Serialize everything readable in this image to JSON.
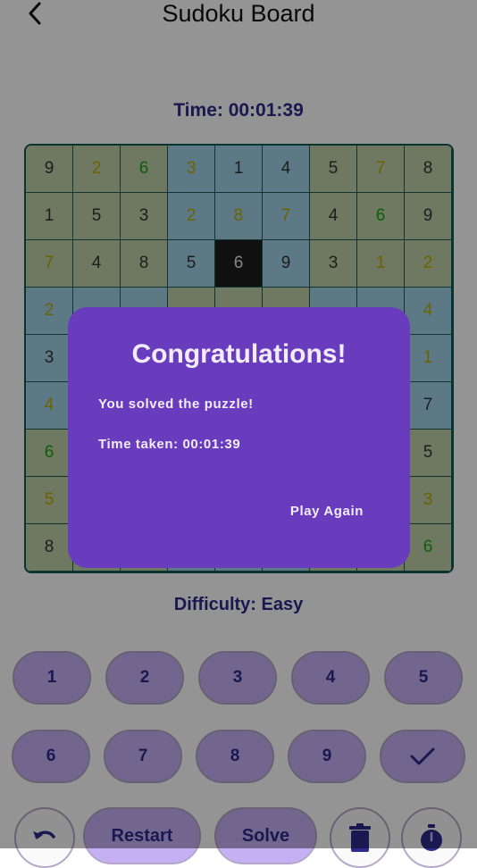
{
  "header": {
    "title": "Sudoku Board",
    "back_icon": "chevron-left-icon"
  },
  "timer": {
    "text": "Time: 00:01:39"
  },
  "board": {
    "rows": [
      [
        {
          "v": "9",
          "bg": "a"
        },
        {
          "v": "2",
          "bg": "a",
          "c": "yellow"
        },
        {
          "v": "6",
          "bg": "a",
          "c": "green"
        },
        {
          "v": "3",
          "bg": "b",
          "c": "yellow"
        },
        {
          "v": "1",
          "bg": "b"
        },
        {
          "v": "4",
          "bg": "b"
        },
        {
          "v": "5",
          "bg": "a"
        },
        {
          "v": "7",
          "bg": "a",
          "c": "yellow"
        },
        {
          "v": "8",
          "bg": "a"
        }
      ],
      [
        {
          "v": "1",
          "bg": "a"
        },
        {
          "v": "5",
          "bg": "a"
        },
        {
          "v": "3",
          "bg": "a"
        },
        {
          "v": "2",
          "bg": "b",
          "c": "yellow"
        },
        {
          "v": "8",
          "bg": "b",
          "c": "yellow"
        },
        {
          "v": "7",
          "bg": "b",
          "c": "yellow"
        },
        {
          "v": "4",
          "bg": "a"
        },
        {
          "v": "6",
          "bg": "a",
          "c": "green"
        },
        {
          "v": "9",
          "bg": "a"
        }
      ],
      [
        {
          "v": "7",
          "bg": "a",
          "c": "yellow"
        },
        {
          "v": "4",
          "bg": "a"
        },
        {
          "v": "8",
          "bg": "a"
        },
        {
          "v": "5",
          "bg": "b"
        },
        {
          "v": "6",
          "bg": "sel"
        },
        {
          "v": "9",
          "bg": "b"
        },
        {
          "v": "3",
          "bg": "a"
        },
        {
          "v": "1",
          "bg": "a",
          "c": "yellow"
        },
        {
          "v": "2",
          "bg": "a",
          "c": "yellow"
        }
      ],
      [
        {
          "v": "2",
          "bg": "b",
          "c": "yellow"
        },
        {
          "v": "",
          "bg": "b"
        },
        {
          "v": "",
          "bg": "b"
        },
        {
          "v": "",
          "bg": "a"
        },
        {
          "v": "",
          "bg": "a"
        },
        {
          "v": "",
          "bg": "a"
        },
        {
          "v": "",
          "bg": "b"
        },
        {
          "v": "",
          "bg": "b"
        },
        {
          "v": "4",
          "bg": "b",
          "c": "yellow"
        }
      ],
      [
        {
          "v": "3",
          "bg": "b"
        },
        {
          "v": "",
          "bg": "b"
        },
        {
          "v": "",
          "bg": "b"
        },
        {
          "v": "",
          "bg": "a"
        },
        {
          "v": "",
          "bg": "a"
        },
        {
          "v": "",
          "bg": "a"
        },
        {
          "v": "",
          "bg": "b"
        },
        {
          "v": "",
          "bg": "b"
        },
        {
          "v": "1",
          "bg": "b",
          "c": "yellow"
        }
      ],
      [
        {
          "v": "4",
          "bg": "b",
          "c": "yellow"
        },
        {
          "v": "",
          "bg": "b"
        },
        {
          "v": "",
          "bg": "b"
        },
        {
          "v": "",
          "bg": "a"
        },
        {
          "v": "",
          "bg": "a"
        },
        {
          "v": "",
          "bg": "a"
        },
        {
          "v": "",
          "bg": "b"
        },
        {
          "v": "",
          "bg": "b"
        },
        {
          "v": "7",
          "bg": "b"
        }
      ],
      [
        {
          "v": "6",
          "bg": "a",
          "c": "green"
        },
        {
          "v": "",
          "bg": "a"
        },
        {
          "v": "",
          "bg": "a"
        },
        {
          "v": "",
          "bg": "b"
        },
        {
          "v": "",
          "bg": "b"
        },
        {
          "v": "",
          "bg": "b"
        },
        {
          "v": "",
          "bg": "a"
        },
        {
          "v": "",
          "bg": "a"
        },
        {
          "v": "5",
          "bg": "a"
        }
      ],
      [
        {
          "v": "5",
          "bg": "a",
          "c": "yellow"
        },
        {
          "v": "",
          "bg": "a"
        },
        {
          "v": "",
          "bg": "a"
        },
        {
          "v": "",
          "bg": "b"
        },
        {
          "v": "",
          "bg": "b"
        },
        {
          "v": "",
          "bg": "b"
        },
        {
          "v": "",
          "bg": "a"
        },
        {
          "v": "",
          "bg": "a"
        },
        {
          "v": "3",
          "bg": "a",
          "c": "yellow"
        }
      ],
      [
        {
          "v": "8",
          "bg": "a"
        },
        {
          "v": "",
          "bg": "a"
        },
        {
          "v": "",
          "bg": "a"
        },
        {
          "v": "",
          "bg": "b"
        },
        {
          "v": "",
          "bg": "b"
        },
        {
          "v": "",
          "bg": "b"
        },
        {
          "v": "",
          "bg": "a"
        },
        {
          "v": "",
          "bg": "a"
        },
        {
          "v": "6",
          "bg": "a",
          "c": "green"
        }
      ]
    ]
  },
  "difficulty": {
    "text": "Difficulty: Easy"
  },
  "number_pad": {
    "row1": [
      "1",
      "2",
      "3",
      "4",
      "5"
    ],
    "row2": [
      "6",
      "7",
      "8",
      "9"
    ],
    "check_icon": "check-icon"
  },
  "bottom_bar": {
    "undo_icon": "undo-icon",
    "restart_label": "Restart",
    "solve_label": "Solve",
    "delete_icon": "trash-icon",
    "timer_icon": "stopwatch-icon"
  },
  "dialog": {
    "title": "Congratulations!",
    "message": "You solved the puzzle!",
    "time_taken": "Time taken: 00:01:39",
    "action_label": "Play Again"
  },
  "colors": {
    "accent": "#683cbc",
    "button_fill": "#c6b0f4",
    "text_primary": "#2d2a8a",
    "cell_olive": "#bfcfa5",
    "cell_blue": "#9fd1e6"
  }
}
